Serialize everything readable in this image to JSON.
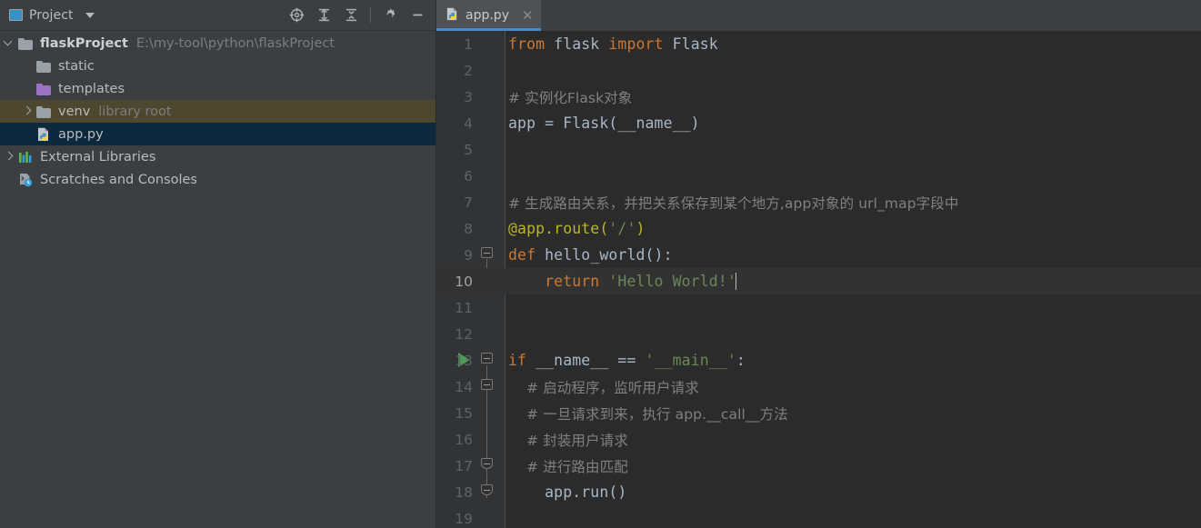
{
  "sidebar": {
    "header": {
      "title": "Project",
      "icon": "project-window-icon",
      "dropdown_icon": "chevron-down-icon",
      "tools": [
        {
          "name": "locate-icon",
          "label": "Select Opened File"
        },
        {
          "name": "expand-all-icon",
          "label": "Expand All"
        },
        {
          "name": "collapse-all-icon",
          "label": "Collapse All"
        },
        {
          "name": "gear-icon",
          "label": "Settings"
        },
        {
          "name": "minimize-icon",
          "label": "Hide"
        }
      ]
    },
    "tree": [
      {
        "label": "flaskProject",
        "secondary": "E:\\my-tool\\python\\flaskProject",
        "icon": "folder-icon",
        "expanded": true,
        "depth": 0,
        "state": "normal",
        "twisty": "chevron-down-icon"
      },
      {
        "label": "static",
        "secondary": "",
        "icon": "folder-icon",
        "expanded": false,
        "depth": 1,
        "state": "normal",
        "twisty": ""
      },
      {
        "label": "templates",
        "secondary": "",
        "icon": "folder-purple-icon",
        "expanded": false,
        "depth": 1,
        "state": "normal",
        "twisty": ""
      },
      {
        "label": "venv",
        "secondary": "library root",
        "icon": "folder-icon",
        "expanded": false,
        "depth": 1,
        "state": "hover",
        "twisty": "chevron-right-icon"
      },
      {
        "label": "app.py",
        "secondary": "",
        "icon": "python-file-icon",
        "expanded": false,
        "depth": 1,
        "state": "selected",
        "twisty": ""
      },
      {
        "label": "External Libraries",
        "secondary": "",
        "icon": "external-libraries-icon",
        "expanded": false,
        "depth": 0,
        "state": "normal",
        "twisty": "chevron-right-icon"
      },
      {
        "label": "Scratches and Consoles",
        "secondary": "",
        "icon": "scratches-icon",
        "expanded": false,
        "depth": 0,
        "state": "normal",
        "twisty": ""
      }
    ]
  },
  "editor": {
    "tabs": [
      {
        "label": "app.py",
        "icon": "python-file-icon",
        "close_icon": "close-icon",
        "active": true
      }
    ],
    "active_tab": "app.py",
    "current_line": 10,
    "accent_color": "#4a88c7",
    "lines": [
      {
        "n": 1,
        "marker": "",
        "tokens": [
          {
            "t": "from ",
            "c": "k"
          },
          {
            "t": "flask ",
            "c": "id"
          },
          {
            "t": "import ",
            "c": "k"
          },
          {
            "t": "Flask",
            "c": "id"
          }
        ]
      },
      {
        "n": 2,
        "marker": "",
        "tokens": []
      },
      {
        "n": 3,
        "marker": "",
        "tokens": [
          {
            "t": "# 实例化Flask对象",
            "c": "c"
          }
        ]
      },
      {
        "n": 4,
        "marker": "",
        "tokens": [
          {
            "t": "app = Flask(__name__)",
            "c": "id"
          }
        ]
      },
      {
        "n": 5,
        "marker": "",
        "tokens": []
      },
      {
        "n": 6,
        "marker": "",
        "tokens": []
      },
      {
        "n": 7,
        "marker": "",
        "tokens": [
          {
            "t": "# 生成路由关系，并把关系保存到某个地方,app对象的 url_map字段中",
            "c": "c"
          }
        ]
      },
      {
        "n": 8,
        "marker": "",
        "tokens": [
          {
            "t": "@app.route(",
            "c": "d"
          },
          {
            "t": "'/'",
            "c": "s"
          },
          {
            "t": ")",
            "c": "d"
          }
        ]
      },
      {
        "n": 9,
        "marker": "fold",
        "tokens": [
          {
            "t": "def ",
            "c": "k"
          },
          {
            "t": "hello_world():",
            "c": "id"
          }
        ]
      },
      {
        "n": 10,
        "marker": "foldend",
        "tokens": [
          {
            "t": "    return ",
            "c": "k"
          },
          {
            "t": "'Hello World!'",
            "c": "s"
          }
        ],
        "caret": true
      },
      {
        "n": 11,
        "marker": "",
        "tokens": []
      },
      {
        "n": 12,
        "marker": "",
        "tokens": []
      },
      {
        "n": 13,
        "marker": "fold-run",
        "tokens": [
          {
            "t": "if ",
            "c": "k"
          },
          {
            "t": "__name__ == ",
            "c": "id"
          },
          {
            "t": "'__main__'",
            "c": "s"
          },
          {
            "t": ":",
            "c": "id"
          }
        ]
      },
      {
        "n": 14,
        "marker": "fold2",
        "tokens": [
          {
            "t": "    # 启动程序，监听用户请求",
            "c": "c"
          }
        ]
      },
      {
        "n": 15,
        "marker": "",
        "tokens": [
          {
            "t": "    # 一旦请求到来，执行 app.__call__方法",
            "c": "c"
          }
        ]
      },
      {
        "n": 16,
        "marker": "",
        "tokens": [
          {
            "t": "    # 封装用户请求",
            "c": "c"
          }
        ]
      },
      {
        "n": 17,
        "marker": "foldend2",
        "tokens": [
          {
            "t": "    # 进行路由匹配",
            "c": "c"
          }
        ]
      },
      {
        "n": 18,
        "marker": "foldend3",
        "tokens": [
          {
            "t": "    app.run()",
            "c": "id"
          }
        ]
      },
      {
        "n": 19,
        "marker": "",
        "tokens": []
      }
    ]
  },
  "colors": {
    "editor_bg": "#2b2b2b",
    "gutter_bg": "#313335",
    "sidebar_bg": "#3c3f41",
    "selection_bg": "#0d293e",
    "hover_bg": "#4d4730",
    "current_line_bg": "#323232",
    "keyword": "#cc7832",
    "string": "#6a8759",
    "comment": "#808080",
    "decorator": "#bbb529",
    "identifier": "#a9b7c6",
    "run_green": "#499c54"
  }
}
